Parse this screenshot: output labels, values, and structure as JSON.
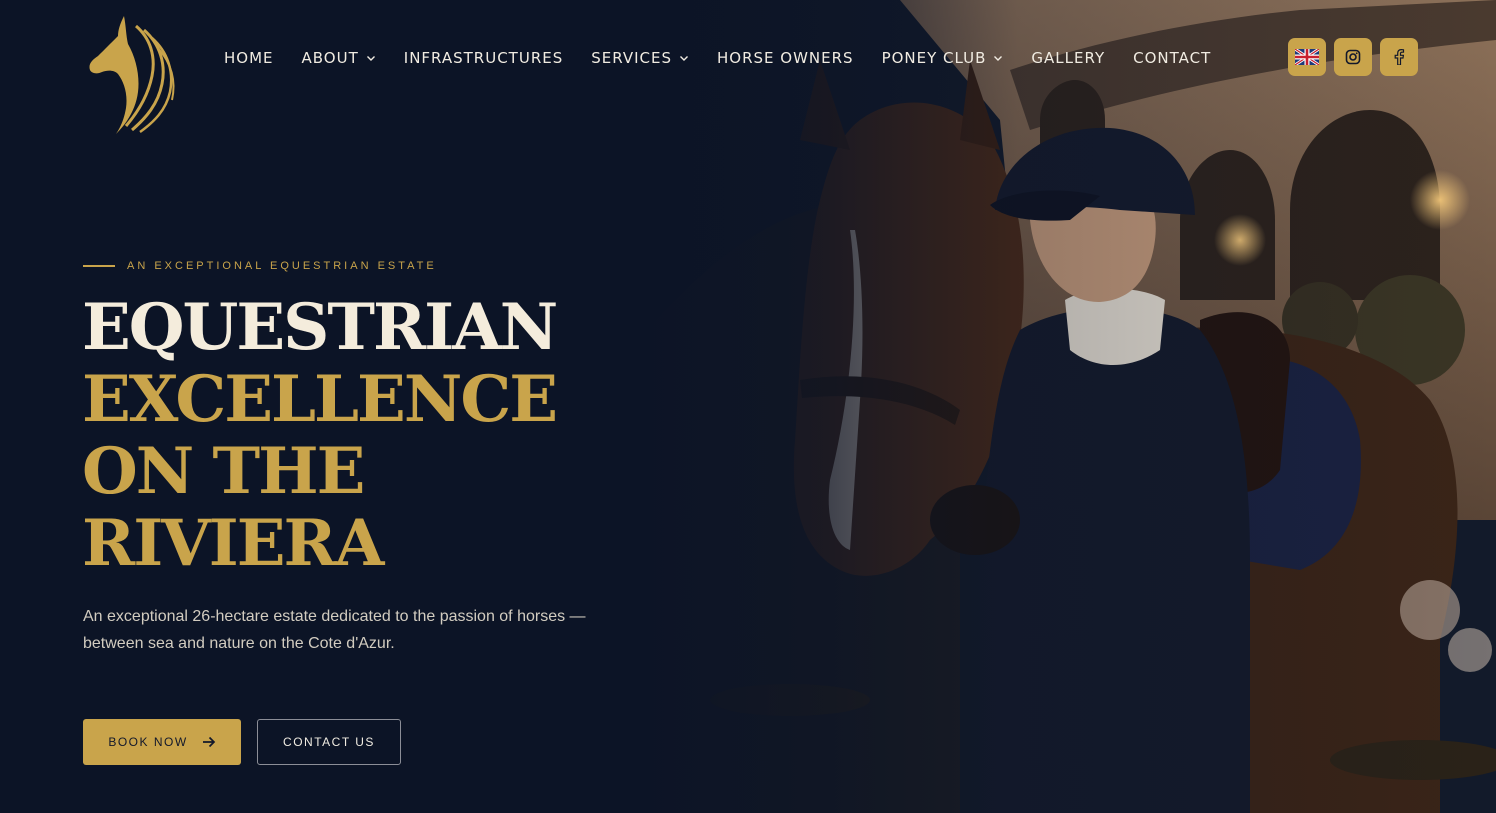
{
  "brand": {
    "logo_icon": "horse-head-logo-icon",
    "accent_color": "#c9a44b",
    "background_color": "#0c1426"
  },
  "nav": {
    "items": [
      {
        "label": "HOME",
        "has_dropdown": false
      },
      {
        "label": "ABOUT",
        "has_dropdown": true
      },
      {
        "label": "INFRASTRUCTURES",
        "has_dropdown": false
      },
      {
        "label": "SERVICES",
        "has_dropdown": true
      },
      {
        "label": "HORSE OWNERS",
        "has_dropdown": false
      },
      {
        "label": "PONEY CLUB",
        "has_dropdown": true
      },
      {
        "label": "GALLERY",
        "has_dropdown": false
      },
      {
        "label": "CONTACT",
        "has_dropdown": false
      }
    ]
  },
  "header_actions": {
    "language_icon": "uk-flag-icon",
    "instagram_icon": "instagram-icon",
    "facebook_icon": "facebook-icon"
  },
  "hero": {
    "eyebrow": "AN EXCEPTIONAL EQUESTRIAN ESTATE",
    "headline_line1": "EQUESTRIAN",
    "headline_line2": "EXCELLENCE",
    "headline_line3": "ON THE",
    "headline_line4": "RIVIERA",
    "subtitle": "An exceptional 26-hectare estate dedicated to the passion of horses — between sea and nature on the Cote d'Azur.",
    "book_button": "BOOK NOW",
    "book_button_icon": "arrow-right-icon",
    "contact_button": "CONTACT US"
  }
}
